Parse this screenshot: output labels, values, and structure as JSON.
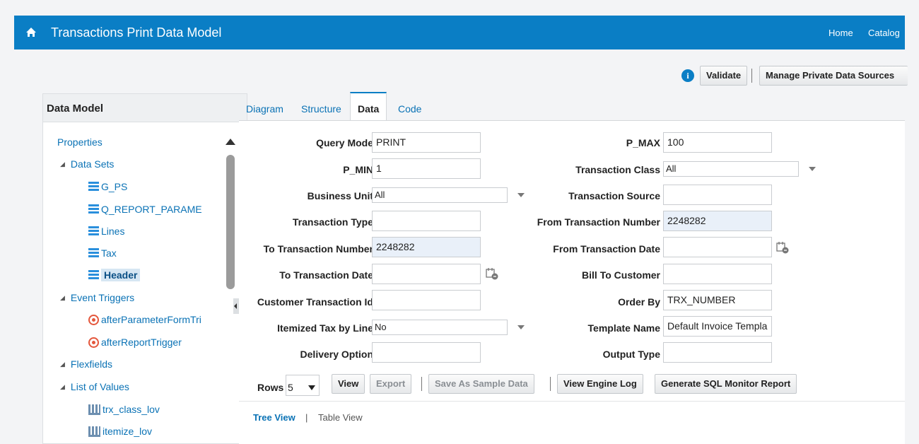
{
  "header": {
    "title": "Transactions Print Data Model",
    "nav": [
      "Home",
      "Catalog"
    ]
  },
  "toolbar": {
    "validate_label": "Validate",
    "manage_label": "Manage Private Data Sources"
  },
  "left_panel": {
    "title": "Data Model",
    "items": [
      {
        "label": "Properties",
        "level": 0,
        "icon": "none"
      },
      {
        "label": "Data Sets",
        "level": 1,
        "icon": "expand-triangle"
      },
      {
        "label": "G_PS",
        "level": 2,
        "icon": "dataset-icon"
      },
      {
        "label": "Q_REPORT_PARAME",
        "level": 2,
        "icon": "dataset-icon"
      },
      {
        "label": "Lines",
        "level": 2,
        "icon": "dataset-icon"
      },
      {
        "label": "Tax",
        "level": 2,
        "icon": "dataset-icon"
      },
      {
        "label": "Header",
        "level": 2,
        "icon": "dataset-icon",
        "selected": true
      },
      {
        "label": "Event Triggers",
        "level": 1,
        "icon": "expand-triangle"
      },
      {
        "label": "afterParameterFormTri",
        "level": 2,
        "icon": "trigger-icon"
      },
      {
        "label": "afterReportTrigger",
        "level": 2,
        "icon": "trigger-icon"
      },
      {
        "label": "Flexfields",
        "level": 1,
        "icon": "expand-triangle"
      },
      {
        "label": "List of Values",
        "level": 1,
        "icon": "expand-triangle"
      },
      {
        "label": "trx_class_lov",
        "level": 2,
        "icon": "lov-icon"
      },
      {
        "label": "itemize_lov",
        "level": 2,
        "icon": "lov-icon"
      }
    ]
  },
  "tabs": [
    "Diagram",
    "Structure",
    "Data",
    "Code"
  ],
  "active_tab": "Data",
  "params": {
    "query_mode": {
      "label": "Query Mode",
      "value": "PRINT"
    },
    "p_min": {
      "label": "P_MIN",
      "value": "1"
    },
    "business_unit": {
      "label": "Business Unit",
      "value": "All"
    },
    "transaction_type": {
      "label": "Transaction Type",
      "value": ""
    },
    "to_trx_number": {
      "label": "To Transaction Number",
      "value": "2248282"
    },
    "to_trx_date": {
      "label": "To Transaction Date",
      "value": ""
    },
    "customer_trx_id": {
      "label": "Customer Transaction Id",
      "value": ""
    },
    "itemized_tax": {
      "label": "Itemized Tax by Line",
      "value": "No"
    },
    "delivery_option": {
      "label": "Delivery Option",
      "value": ""
    },
    "p_max": {
      "label": "P_MAX",
      "value": "100"
    },
    "transaction_class": {
      "label": "Transaction Class",
      "value": "All"
    },
    "transaction_source": {
      "label": "Transaction Source",
      "value": ""
    },
    "from_trx_number": {
      "label": "From Transaction Number",
      "value": "2248282"
    },
    "from_trx_date": {
      "label": "From Transaction Date",
      "value": ""
    },
    "bill_to_customer": {
      "label": "Bill To Customer",
      "value": ""
    },
    "order_by": {
      "label": "Order By",
      "value": "TRX_NUMBER"
    },
    "template_name": {
      "label": "Template Name",
      "value": "Default Invoice Templa"
    },
    "output_type": {
      "label": "Output Type",
      "value": ""
    }
  },
  "actions": {
    "rows_label": "Rows",
    "rows_value": "5",
    "view": "View",
    "export": "Export",
    "save_sample": "Save As Sample Data",
    "engine_log": "View Engine Log",
    "sql_monitor": "Generate SQL Monitor Report"
  },
  "view_links": {
    "tree": "Tree View",
    "table": "Table View"
  },
  "colors": {
    "brand": "#0a7ec5",
    "link": "#0a72b5",
    "highlight": "#e9f0f9"
  }
}
